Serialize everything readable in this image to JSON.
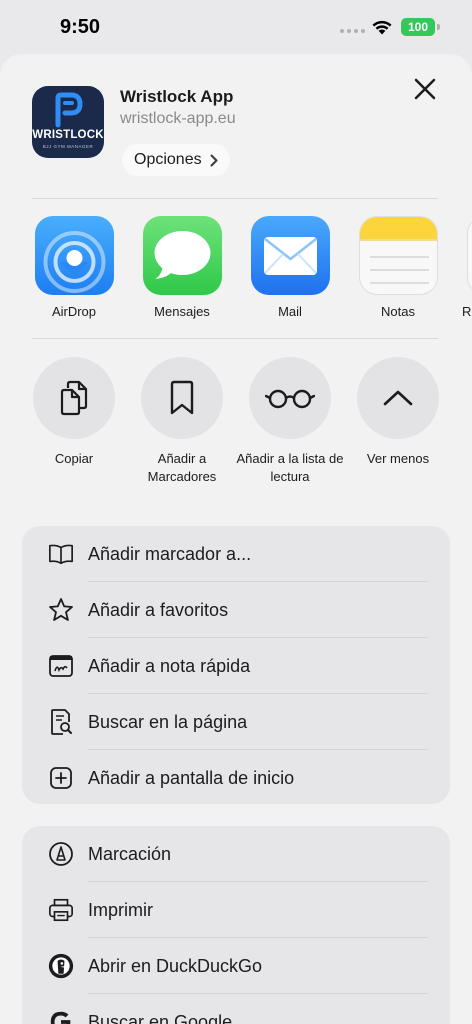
{
  "status_bar": {
    "time": "9:50",
    "battery": "100"
  },
  "app": {
    "name": "Wristlock App",
    "url": "wristlock-app.eu",
    "options_label": "Opciones",
    "logo_text": "WRISTLOCK",
    "logo_subtext": "BJJ GYM MANAGER"
  },
  "share_apps": [
    {
      "label": "AirDrop",
      "icon": "airdrop-icon"
    },
    {
      "label": "Mensajes",
      "icon": "messages-icon"
    },
    {
      "label": "Mail",
      "icon": "mail-icon"
    },
    {
      "label": "Notas",
      "icon": "notes-icon"
    },
    {
      "label": "R",
      "icon": "reminders-icon"
    }
  ],
  "actions": [
    {
      "label": "Copiar",
      "icon": "copy-icon"
    },
    {
      "label": "Añadir a Marcadores",
      "icon": "bookmark-icon"
    },
    {
      "label": "Añadir a la lista de lectura",
      "icon": "glasses-icon"
    },
    {
      "label": "Ver menos",
      "icon": "chevron-up-icon"
    }
  ],
  "menu_group_1": [
    {
      "label": "Añadir marcador a...",
      "icon": "book-icon"
    },
    {
      "label": "Añadir a favoritos",
      "icon": "star-icon"
    },
    {
      "label": "Añadir a nota rápida",
      "icon": "quick-note-icon"
    },
    {
      "label": "Buscar en la página",
      "icon": "find-in-page-icon"
    },
    {
      "label": "Añadir a pantalla de inicio",
      "icon": "add-square-icon"
    }
  ],
  "menu_group_2": [
    {
      "label": "Marcación",
      "icon": "markup-icon"
    },
    {
      "label": "Imprimir",
      "icon": "printer-icon"
    },
    {
      "label": "Abrir en DuckDuckGo",
      "icon": "duckduckgo-icon"
    },
    {
      "label": "Buscar en Google",
      "icon": "google-icon"
    }
  ],
  "colors": {
    "sheet_bg": "#f2f2f2",
    "group_bg": "#e6e6e8",
    "battery": "#34c759",
    "accent_blue": "#1f71ef"
  }
}
